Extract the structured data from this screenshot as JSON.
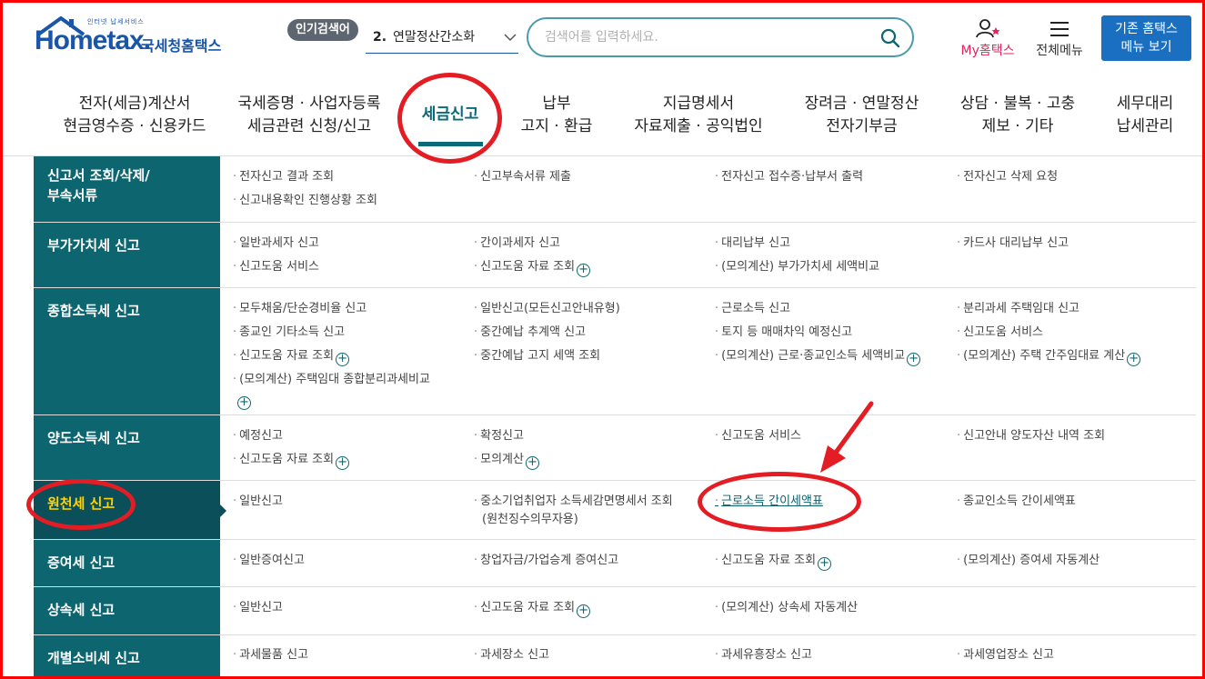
{
  "header": {
    "logo_sub": "인터넷 납세서비스",
    "logo_main": "Hometax.",
    "logo_kr": "국세청홈택스",
    "popular_badge": "인기검색어",
    "popular_rank": "2.",
    "popular_term": "연말정산간소화",
    "search_placeholder": "검색어를 입력하세요.",
    "my_hometax": "My홈택스",
    "all_menu": "전체메뉴",
    "old_menu_line1": "기존 홈택스",
    "old_menu_line2": "메뉴 보기"
  },
  "nav": [
    {
      "l1": "전자(세금)계산서",
      "l2": "현금영수증 · 신용카드"
    },
    {
      "l1": "국세증명 · 사업자등록",
      "l2": "세금관련 신청/신고"
    },
    {
      "l1": "세금신고",
      "l2": ""
    },
    {
      "l1": "납부",
      "l2": "고지 · 환급"
    },
    {
      "l1": "지급명세서",
      "l2": "자료제출 · 공익법인"
    },
    {
      "l1": "장려금 · 연말정산",
      "l2": "전자기부금"
    },
    {
      "l1": "상담 · 불복 · 고충",
      "l2": "제보 · 기타"
    },
    {
      "l1": "세무대리",
      "l2": "납세관리"
    }
  ],
  "menu": [
    {
      "title": "신고서 조회/삭제/부속서류",
      "title_l1": "신고서 조회/삭제/",
      "title_l2": "부속서류",
      "items": [
        "전자신고 결과 조회",
        "신고부속서류 제출",
        "전자신고 접수증·납부서 출력",
        "전자신고 삭제 요청",
        "신고내용확인 진행상황 조회"
      ]
    },
    {
      "title": "부가가치세 신고",
      "items": [
        "일반과세자 신고",
        "간이과세자 신고",
        "대리납부 신고",
        "카드사 대리납부 신고",
        "신고도움 서비스",
        "신고도움 자료 조회",
        "(모의계산) 부가가치세 세액비교"
      ]
    },
    {
      "title": "종합소득세 신고",
      "items": [
        "모두채움/단순경비율 신고",
        "일반신고(모든신고안내유형)",
        "근로소득 신고",
        "분리과세 주택임대 신고",
        "종교인 기타소득 신고",
        "중간예납 추계액 신고",
        "토지 등 매매차익 예정신고",
        "신고도움 서비스",
        "신고도움 자료 조회",
        "중간예납 고지 세액 조회",
        "(모의계산) 근로·종교인소득 세액비교",
        "(모의계산) 주택 간주임대료 계산",
        "(모의계산) 주택임대 종합분리과세비교"
      ]
    },
    {
      "title": "양도소득세 신고",
      "items": [
        "예정신고",
        "확정신고",
        "신고도움 서비스",
        "신고안내 양도자산 내역 조회",
        "신고도움 자료 조회",
        "모의계산"
      ]
    },
    {
      "title": "원천세 신고",
      "items": [
        "일반신고",
        "중소기업취업자 소득세감면명세서 조회",
        "(원천징수의무자용)",
        "근로소득 간이세액표",
        "종교인소득 간이세액표"
      ]
    },
    {
      "title": "증여세 신고",
      "items": [
        "일반증여신고",
        "창업자금/가업승계 증여신고",
        "신고도움 자료 조회",
        "(모의계산) 증여세 자동계산"
      ]
    },
    {
      "title": "상속세 신고",
      "items": [
        "일반신고",
        "신고도움 자료 조회",
        "(모의계산) 상속세 자동계산"
      ]
    },
    {
      "title": "개별소비세 신고",
      "items": [
        "과세물품 신고",
        "과세장소 신고",
        "과세유흥장소 신고",
        "과세영업장소 신고"
      ]
    }
  ],
  "colors": {
    "accent": "#0d6570",
    "active_head": "#0a4f59",
    "active_text": "#ffd400",
    "annotation": "#e41c23",
    "brand": "#1a56a8"
  }
}
